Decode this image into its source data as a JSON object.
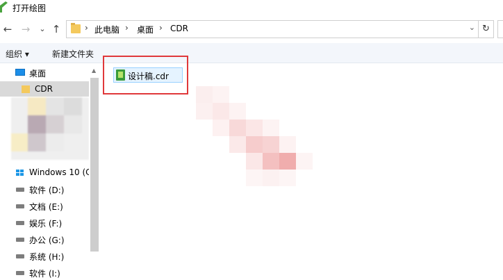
{
  "window": {
    "title": "打开绘图"
  },
  "nav": {
    "back": "←",
    "forward": "→",
    "dropdown": "⌄",
    "up": "↑"
  },
  "address": {
    "segments": [
      "此电脑",
      "桌面",
      "CDR"
    ],
    "separator": "›",
    "dropdown": "⌄"
  },
  "refresh_symbol": "↻",
  "toolbar": {
    "organize": "组织 ▾",
    "new_folder": "新建文件夹"
  },
  "sidebar": {
    "items": [
      {
        "label": "桌面",
        "icon": "desktop-icon"
      },
      {
        "label": "CDR",
        "icon": "folder-icon",
        "selected": true
      },
      {
        "label": "Windows 10 (C",
        "icon": "windows-icon"
      },
      {
        "label": "软件 (D:)",
        "icon": "drive-icon"
      },
      {
        "label": "文档 (E:)",
        "icon": "drive-icon"
      },
      {
        "label": "娱乐 (F:)",
        "icon": "drive-icon"
      },
      {
        "label": "办公 (G:)",
        "icon": "drive-icon"
      },
      {
        "label": "系统 (H:)",
        "icon": "drive-icon"
      },
      {
        "label": "软件 (I:)",
        "icon": "drive-icon"
      }
    ]
  },
  "files": [
    {
      "name": "设计稿.cdr",
      "icon": "coreldraw-file-icon"
    }
  ],
  "colors": {
    "highlight": "#e0383a",
    "toolbar_bg": "#f3f6fb",
    "selection": "#d9d9d9"
  }
}
